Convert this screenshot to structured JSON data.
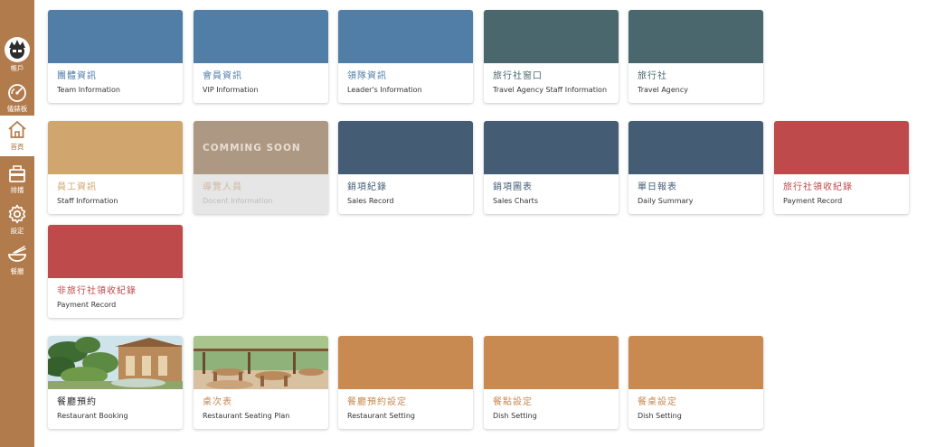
{
  "sidebar": {
    "items": [
      {
        "label": "帳戶",
        "icon": "avatar-icon"
      },
      {
        "label": "儀錶板",
        "icon": "gauge-icon"
      },
      {
        "label": "首頁",
        "icon": "home-icon"
      },
      {
        "label": "排播",
        "icon": "schedule-icon"
      },
      {
        "label": "設定",
        "icon": "gear-icon"
      },
      {
        "label": "餐廳",
        "icon": "bowl-icon"
      }
    ],
    "active": "首頁"
  },
  "colors": {
    "sidebar": "#b27b4b",
    "blue": "#507ea7",
    "slate_green": "#4a676d",
    "tan": "#d1a56e",
    "taupe": "#ad9883",
    "navy_slate": "#445c74",
    "red": "#bf4a4b",
    "orange": "#c98a51"
  },
  "cards": [
    {
      "zh": "團體資訊",
      "en": "Team Information"
    },
    {
      "zh": "會員資訊",
      "en": "VIP Information"
    },
    {
      "zh": "領隊資訊",
      "en": "Leader's Information"
    },
    {
      "zh": "旅行社窗口",
      "en": "Travel Agency Staff Information"
    },
    {
      "zh": "旅行社",
      "en": "Travel Agency"
    },
    {
      "zh": "員工資訊",
      "en": "Staff Information"
    },
    {
      "zh": "導覽人員",
      "en": "Docent Information",
      "badge": "COMMING SOON"
    },
    {
      "zh": "銷項紀錄",
      "en": "Sales Record"
    },
    {
      "zh": "銷項圖表",
      "en": "Sales Charts"
    },
    {
      "zh": "單日報表",
      "en": "Daily Summary"
    },
    {
      "zh": "旅行社領收紀錄",
      "en": "Payment Record"
    },
    {
      "zh": "非旅行社領收紀錄",
      "en": "Payment Record"
    },
    {
      "zh": "餐廳預約",
      "en": "Restaurant Booking"
    },
    {
      "zh": "桌次表",
      "en": "Restaurant Seating Plan"
    },
    {
      "zh": "餐廳預約設定",
      "en": "Restaurant Setting"
    },
    {
      "zh": "餐點設定",
      "en": "Dish Setting"
    },
    {
      "zh": "餐桌設定",
      "en": "Dish Setting"
    }
  ]
}
